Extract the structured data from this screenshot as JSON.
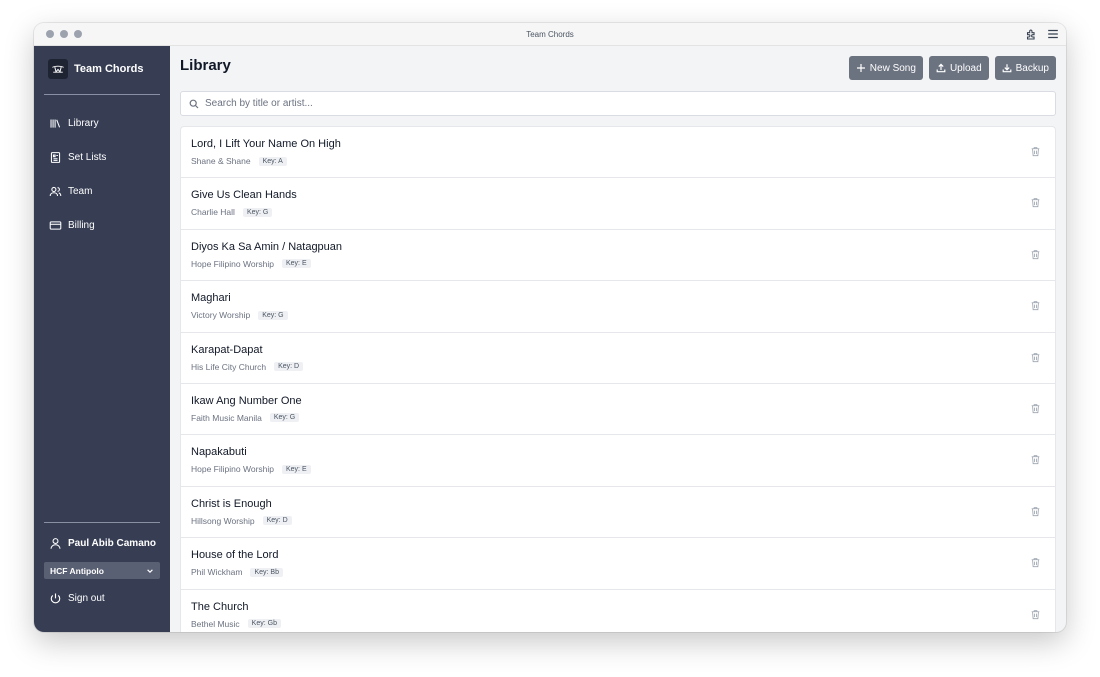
{
  "window": {
    "title": "Team Chords"
  },
  "sidebar": {
    "brand": "Team Chords",
    "nav": [
      {
        "label": "Library",
        "icon": "library-icon"
      },
      {
        "label": "Set Lists",
        "icon": "setlist-icon"
      },
      {
        "label": "Team",
        "icon": "team-icon"
      },
      {
        "label": "Billing",
        "icon": "credit-card-icon"
      }
    ],
    "user": "Paul Abib Camano",
    "org": "HCF Antipolo",
    "signout": "Sign out"
  },
  "main": {
    "title": "Library",
    "actions": {
      "new_song": "New Song",
      "upload": "Upload",
      "backup": "Backup"
    },
    "search": {
      "placeholder": "Search by title or artist...",
      "value": ""
    },
    "songs": [
      {
        "title": "Lord, I Lift Your Name On High",
        "artist": "Shane & Shane",
        "key": "Key: A"
      },
      {
        "title": "Give Us Clean Hands",
        "artist": "Charlie Hall",
        "key": "Key: G"
      },
      {
        "title": "Diyos Ka Sa Amin / Natagpuan",
        "artist": "Hope Filipino Worship",
        "key": "Key: E"
      },
      {
        "title": "Maghari",
        "artist": "Victory Worship",
        "key": "Key: G"
      },
      {
        "title": "Karapat-Dapat",
        "artist": "His Life City Church",
        "key": "Key: D"
      },
      {
        "title": "Ikaw Ang Number One",
        "artist": "Faith Music Manila",
        "key": "Key: G"
      },
      {
        "title": "Napakabuti",
        "artist": "Hope Filipino Worship",
        "key": "Key: E"
      },
      {
        "title": "Christ is Enough",
        "artist": "Hillsong Worship",
        "key": "Key: D"
      },
      {
        "title": "House of the Lord",
        "artist": "Phil Wickham",
        "key": "Key: Bb"
      },
      {
        "title": "The Church",
        "artist": "Bethel Music",
        "key": "Key: Gb"
      }
    ]
  },
  "colors": {
    "sidebar": "#373e54",
    "button": "#6b7280",
    "background": "#f3f4f6"
  }
}
